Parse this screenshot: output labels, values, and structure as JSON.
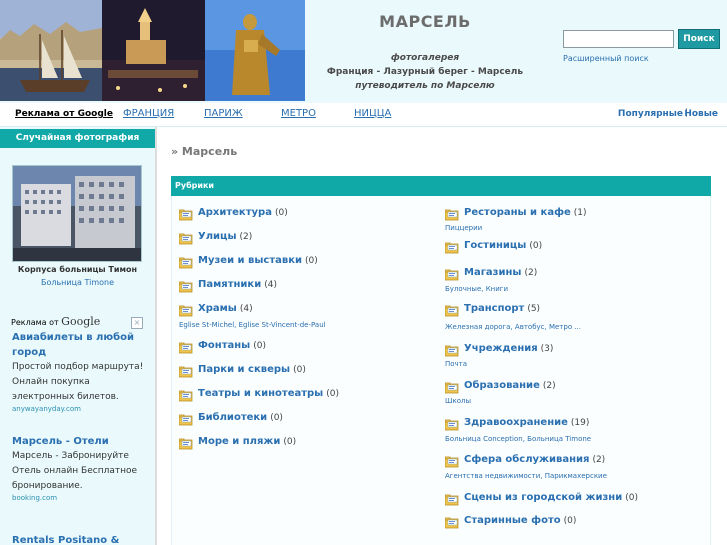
{
  "header": {
    "title": "МАРСЕЛЬ",
    "subtitle_lines": [
      "фотогалерея",
      "Франция - Лазурный берег - Марсель",
      "путеводитель по Марселю"
    ],
    "search": {
      "button_label": "Поиск",
      "placeholder": "",
      "advanced_link": "Расширенный поиск"
    }
  },
  "nav": {
    "google_ads": "Реклама от Google",
    "items": [
      "ФРАНЦИЯ",
      "ПАРИЖ",
      "МЕТРО",
      "НИЦЦА"
    ],
    "popular": "Популярные",
    "separator": "|",
    "new": "Новые"
  },
  "sidebar": {
    "random_header": "Случайная фотография",
    "photo_caption": "Корпуса больницы Тимон",
    "photo_sub": "Больница Timone",
    "ads_label_prefix": "Реклама от ",
    "ads_label_brand": "Google",
    "ads": [
      {
        "title": "Авиабилеты в любой город",
        "body": "Простой подбор маршрута! Онлайн покупка электронных билетов.",
        "url": "anywayanyday.com"
      },
      {
        "title": "Марсель - Отели",
        "body": "Марсель - Забронируйте Отель онлайн Бесплатное бронирование.",
        "url": "booking.com"
      },
      {
        "title": "Rentals Positano &",
        "body": "",
        "url": ""
      }
    ]
  },
  "content": {
    "breadcrumb": "» Марсель",
    "rubrics_title": "Рубрики",
    "left_categories": [
      {
        "name": "Архитектура",
        "count": "(0)",
        "sub": ""
      },
      {
        "name": "Улицы",
        "count": "(2)",
        "sub": ""
      },
      {
        "name": "Музеи и выставки",
        "count": "(0)",
        "sub": ""
      },
      {
        "name": "Памятники",
        "count": "(4)",
        "sub": ""
      },
      {
        "name": "Храмы",
        "count": "(4)",
        "sub": "Eglise St-Michel, Eglise St-Vincent-de-Paul"
      },
      {
        "name": "Фонтаны",
        "count": "(0)",
        "sub": ""
      },
      {
        "name": "Парки и скверы",
        "count": "(0)",
        "sub": ""
      },
      {
        "name": "Театры и кинотеатры",
        "count": "(0)",
        "sub": ""
      },
      {
        "name": "Библиотеки",
        "count": "(0)",
        "sub": ""
      },
      {
        "name": "Море и пляжи",
        "count": "(0)",
        "sub": ""
      }
    ],
    "right_categories": [
      {
        "name": "Рестораны и кафе",
        "count": "(1)",
        "sub": "Пиццерии"
      },
      {
        "name": "Гостиницы",
        "count": "(0)",
        "sub": ""
      },
      {
        "name": "Магазины",
        "count": "(2)",
        "sub": "Булочные, Книги"
      },
      {
        "name": "Транспорт",
        "count": "(5)",
        "sub": "Железная дорога, Автобус, Метро ..."
      },
      {
        "name": "Учреждения",
        "count": "(3)",
        "sub": "Почта"
      },
      {
        "name": "Образование",
        "count": "(2)",
        "sub": "Школы"
      },
      {
        "name": "Здравоохранение",
        "count": "(19)",
        "sub": "Больница Conception, Больница Timone"
      },
      {
        "name": "Сфера обслуживания",
        "count": "(2)",
        "sub": "Агентства недвижимости, Парикмахерские"
      },
      {
        "name": "Сцены из городской жизни",
        "count": "(0)",
        "sub": ""
      },
      {
        "name": "Старинные фото",
        "count": "(0)",
        "sub": ""
      }
    ]
  },
  "colors": {
    "accent": "#10a9a8",
    "link": "#2a6fb0",
    "header_bg": "#eafafc"
  },
  "icons": {
    "category": "folder-icon",
    "close": "close-icon"
  }
}
